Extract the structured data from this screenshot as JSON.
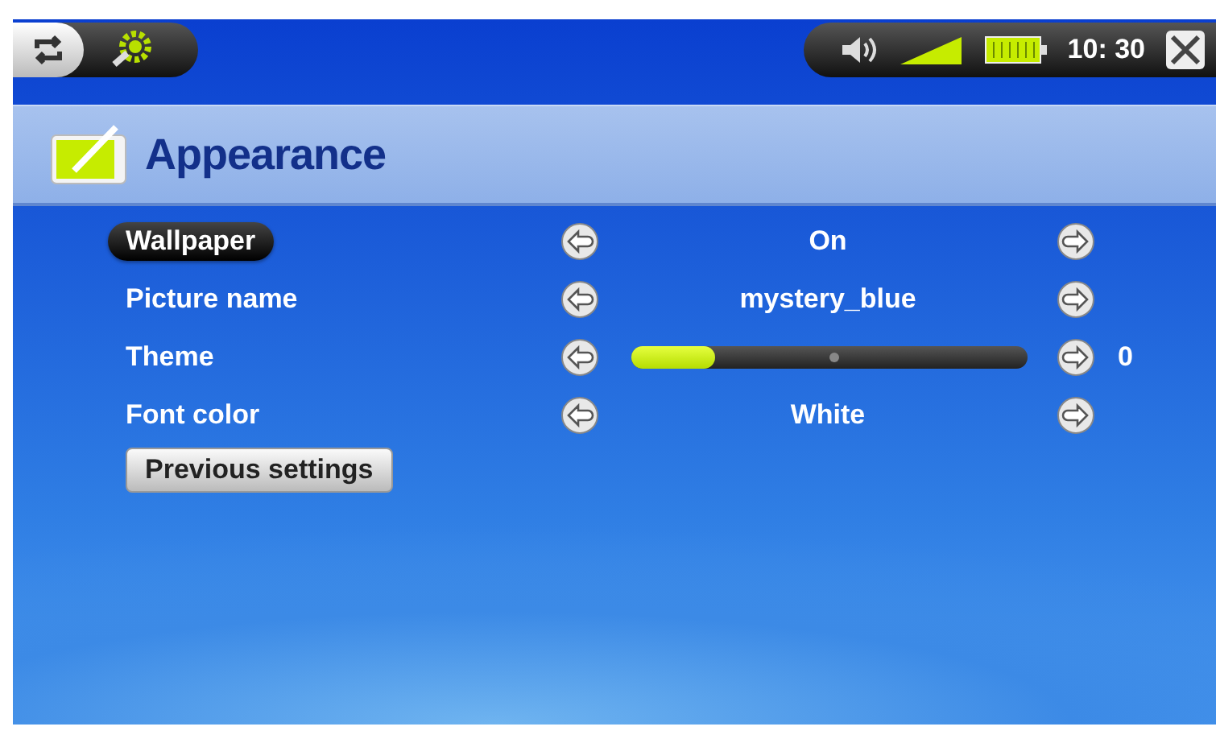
{
  "status_bar": {
    "time": "10: 30"
  },
  "header": {
    "title": "Appearance"
  },
  "settings": [
    {
      "kind": "choice",
      "label": "Wallpaper",
      "selected": true,
      "value": "On"
    },
    {
      "kind": "choice",
      "label": "Picture name",
      "selected": false,
      "value": "mystery_blue"
    },
    {
      "kind": "slider",
      "label": "Theme",
      "selected": false,
      "level": 0.21,
      "reading": "0"
    },
    {
      "kind": "choice",
      "label": "Font color",
      "selected": false,
      "value": "White"
    }
  ],
  "buttons": [
    {
      "label": "Previous settings"
    }
  ]
}
